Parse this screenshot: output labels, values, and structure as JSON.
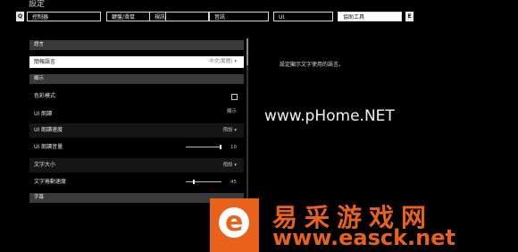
{
  "header": {
    "title": "設定",
    "key_left": "Q",
    "key_right": "E"
  },
  "tabs": [
    {
      "label": "控制器"
    },
    {
      "label": "鍵盤/滑鼠"
    },
    {
      "label": "視訊"
    },
    {
      "label": "音訊"
    },
    {
      "label": "UI"
    },
    {
      "label": "協助工具",
      "active": true
    }
  ],
  "sections": {
    "language": "語言",
    "display": "顯示",
    "subtitles": "字幕"
  },
  "rows": {
    "display_language": {
      "label": "簡報語言",
      "value": "中文(繁體)"
    },
    "colorblind_mode": {
      "label": "色彩模式"
    },
    "ui_narration": {
      "label": "UI 朗讀",
      "value": "顯示"
    },
    "ui_narration_speed": {
      "label": "UI 朗讀速度",
      "value": "預設"
    },
    "ui_narration_volume": {
      "label": "UI 朗讀音量",
      "value": "10"
    },
    "text_size": {
      "label": "文字大小",
      "value": "預設"
    },
    "text_scroll_speed": {
      "label": "文字捲動速度",
      "value": "45"
    }
  },
  "description": "設定顯示文字使用的語言。",
  "watermarks": {
    "phome": "www.pHome.NET",
    "cn": "易采游戏网",
    "url": "www.easck.net",
    "logo_letter": "e"
  },
  "colors": {
    "watermark_orange": "#e8621b",
    "active_tab": "#ffffff",
    "section_bg": "#3a3a3a"
  }
}
